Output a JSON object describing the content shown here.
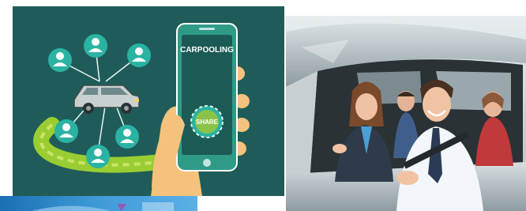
{
  "left_panel": {
    "phone_title": "CARPOOLING",
    "phone_button": "SHARE"
  },
  "colors": {
    "panel_bg": "#1f5c59",
    "teal_circle": "#2ab3a3",
    "road_green": "#9acd32",
    "phone_body": "#2f9b87",
    "phone_screen": "#1c5a55",
    "hand": "#f4c27c",
    "car": "#c9d1d0"
  },
  "icons": [
    "person-icon",
    "person-icon",
    "person-icon",
    "person-icon",
    "person-icon",
    "person-icon",
    "car-icon",
    "smartphone-icon",
    "hand-icon"
  ]
}
